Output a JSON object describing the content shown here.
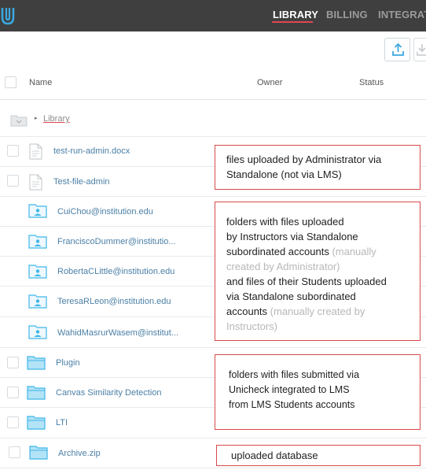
{
  "topbar": {
    "logo_icon": "unicheck-logo-icon",
    "nav": [
      {
        "label": "LIBRARY",
        "active": true
      },
      {
        "label": "BILLING",
        "active": false
      },
      {
        "label": "INTEGRAT",
        "active": false
      }
    ]
  },
  "toolbar": {
    "upload_icon": "upload-icon",
    "download_icon": "download-icon"
  },
  "table": {
    "columns": {
      "name": "Name",
      "owner": "Owner",
      "status": "Status"
    }
  },
  "breadcrumb": {
    "arrow": "▸",
    "label": "Library"
  },
  "rows": [
    {
      "type": "file",
      "name": "test-run-admin.docx"
    },
    {
      "type": "file",
      "name": "Test-file-admin"
    },
    {
      "type": "user-folder",
      "name": "CuiChou@institution.edu"
    },
    {
      "type": "user-folder",
      "name": "FranciscoDummer@institutio..."
    },
    {
      "type": "user-folder",
      "name": "RobertaCLittle@institution.edu"
    },
    {
      "type": "user-folder",
      "name": "TeresaRLeon@institution.edu"
    },
    {
      "type": "user-folder",
      "name": "WahidMasrurWasem@institut..."
    },
    {
      "type": "folder",
      "name": "Plugin"
    },
    {
      "type": "folder",
      "name": "Canvas Similarity Detection"
    },
    {
      "type": "folder",
      "name": "LTI"
    },
    {
      "type": "folder",
      "name": "Archive.zip"
    }
  ],
  "notes": {
    "admin": {
      "line1": "files uploaded by Administrator via",
      "line2": "Standalone (not via LMS)"
    },
    "instructors": {
      "l1": "folders with files uploaded",
      "l2": "by Instructors via Standalone",
      "l3": "subordinated accounts ",
      "l3_muted": "(manually",
      "l4_muted": "created by Administrator)",
      "l5": "and files of their Students uploaded",
      "l6": "via Standalone subordinated",
      "l7": "accounts ",
      "l7_muted": "(manually created by",
      "l8_muted": "Instructors)"
    },
    "lms": {
      "l1": "folders with files submitted via",
      "l2": "Unicheck integrated to LMS",
      "l3": "from LMS Students accounts"
    },
    "db": {
      "label": "uploaded database"
    }
  },
  "colors": {
    "topbar": "#3f3f3f",
    "accent": "#e2464f",
    "link": "#4b7fa6",
    "folder": "#3fb6e8",
    "note_border": "#d84a4a"
  }
}
